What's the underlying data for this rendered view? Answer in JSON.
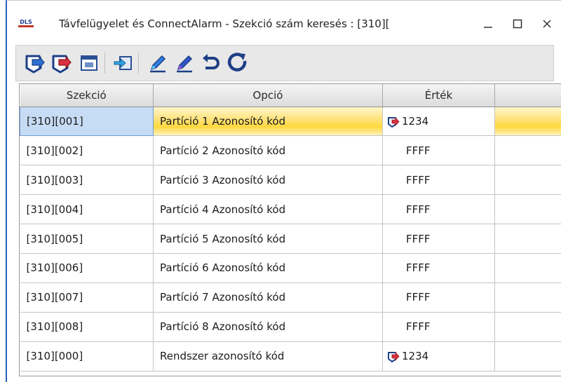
{
  "window": {
    "title": "Távfelügyelet és ConnectAlarm - Szekció szám keresés : [310][",
    "logo_text": "DLS",
    "accent_color": "#2b5fb6"
  },
  "toolbar": {
    "buttons": [
      {
        "icon": "download-icon",
        "label": ""
      },
      {
        "icon": "upload-icon",
        "label": ""
      },
      {
        "icon": "panel-icon",
        "label": ""
      },
      {
        "icon": "import-icon",
        "label": ""
      },
      {
        "icon": "edit-icon",
        "label": ""
      },
      {
        "icon": "edit-alt-icon",
        "label": ""
      },
      {
        "icon": "undo-icon",
        "label": ""
      },
      {
        "icon": "refresh-icon",
        "label": ""
      }
    ]
  },
  "grid": {
    "headers": [
      "Szekció",
      "Opció",
      "Érték",
      ""
    ],
    "rows": [
      {
        "section": "[310][001]",
        "option": "Partíció 1 Azonosító kód",
        "value": "1234",
        "has_icon": true
      },
      {
        "section": "[310][002]",
        "option": "Partíció 2 Azonosító kód",
        "value": "FFFF",
        "has_icon": false
      },
      {
        "section": "[310][003]",
        "option": "Partíció 3 Azonosító kód",
        "value": "FFFF",
        "has_icon": false
      },
      {
        "section": "[310][004]",
        "option": "Partíció 4 Azonosító kód",
        "value": "FFFF",
        "has_icon": false
      },
      {
        "section": "[310][005]",
        "option": "Partíció 5 Azonosító kód",
        "value": "FFFF",
        "has_icon": false
      },
      {
        "section": "[310][006]",
        "option": "Partíció 6 Azonosító kód",
        "value": "FFFF",
        "has_icon": false
      },
      {
        "section": "[310][007]",
        "option": "Partíció 7 Azonosító kód",
        "value": "FFFF",
        "has_icon": false
      },
      {
        "section": "[310][008]",
        "option": "Partíció 8 Azonosító kód",
        "value": "FFFF",
        "has_icon": false
      },
      {
        "section": "[310][000]",
        "option": "Rendszer azonosító kód",
        "value": "1234",
        "has_icon": true
      }
    ],
    "selected_row": 0
  }
}
